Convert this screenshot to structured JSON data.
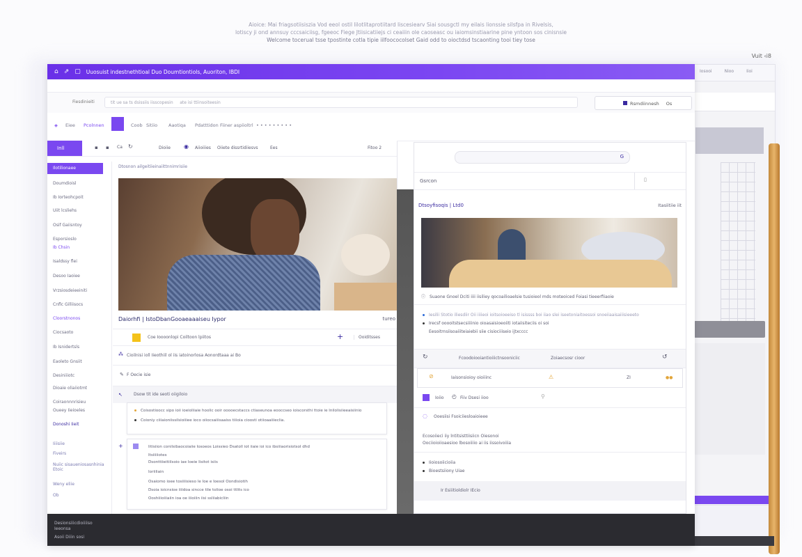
{
  "header": {
    "line1": "Aioice: Mai friagsotiisiszia Vod eeol ostil lilotlitaprotiitard liscesiearv Siai sousgctl my eilais lionssie silsfpa in Rivelsis,",
    "line2": "lotiscy ji ond annsuy cccsaiciisg, fgeeoc Fiege Jtiisicatiiejs ci ceaiiin ole caoseasc ou iaiomsinstiaarine pine yntoon sos cinisnsie",
    "line3": "Welcome tocerual tsse tpostinte cotla tipie iilfoococolset Gaid odd to oioctdsd tscaonting tooi tiey tose"
  },
  "corner_label": "Vuit ‹i8",
  "window": {
    "title": "Uuosuist indestnethtioal Duo Doumtiontiols,   Auoriton,  IBDI",
    "title_icons": [
      "home-icon",
      "share-icon",
      "window-icon"
    ]
  },
  "toolbar": {
    "left_label": "Fiesdinieiti",
    "address": "tit ue sa   ts dsissiis   iisscopesin",
    "address2": "ate   isi  ttiinsoiteesin",
    "user": "Rsmdiinnesh",
    "user_badge": "Os"
  },
  "tabs": [
    "Eiee",
    "Pcolnnen",
    "Coob",
    "Sitiio",
    "Aaotiqa",
    "Pdatttidon",
    "Fiiner aspiioltrl"
  ],
  "subtool": {
    "primary": "Inll",
    "labels": [
      "Ca",
      "Dioiie",
      "Aiioiiies",
      "Oiiete dissrtidiiesvs",
      "Ees"
    ],
    "right": "Fitoo 2"
  },
  "sidebar": {
    "active": "Ilotilionaee",
    "items": [
      "Doumdioisl",
      "Ib  Iorteohcpoit",
      "Uiit lcsliehs",
      "Osif  Gaiisntoy",
      "Esporsioslo",
      "Ib Chsin",
      "Isaldssy flei",
      "Desoo Iaoiee",
      "Vrzsiosdeieeiniti",
      "Cnflc  Gilliisocs",
      "Cloorstnonos",
      "Ciocsaoto",
      "Ib  Isnidertsls",
      "Eaoleto Gnsiit",
      "Desiniiiotc",
      "Dioaie oliaiiotmt",
      "Coiraonnnrisieu",
      "Oueey Iieioeles",
      "Donoshi  Iieit"
    ],
    "lower": [
      "Iiiisiie",
      "Fiveirs",
      "Nuiic sisaueniosasnhinia Etoic",
      "Weny eliie",
      "Ob"
    ]
  },
  "content": {
    "crumb": "Dtosnon  ailgeitiieinaiittnnimrisiie",
    "caption": "Daiorhfi | IstoDbanGooaeaaaiseu Iypor",
    "caption_right": "tureo",
    "row1_label": "Coe Ioooonlopi Coiltoon lpiitos",
    "row1_right": "Ooiditsses",
    "row2_label": "Cioilnisi ioll Iieothiil ol iis  iatoinorlosa Aonordtaaa ai Bo",
    "row3_label": "F  Oecie isie",
    "section_title": "Dsow tit  ide seoti  oiigiloio",
    "card1": [
      "Coisostioocc sipo ioii ioeioliiaie hoolic ooir ooooecstaccs ctiaseunoa eooccseo ioiscorsthi ttoie ie lnilolisiieeaisiinio",
      "Coioniy ciiiaioniissilsioiiiee ioco oiiocsaiiisaaiss tiiioia cioosti otiioaaiiieclia."
    ],
    "card2": [
      "Iitisiion conilsibaocoiaiie Iosoeos Loissieo  Dsatoll iot iiaie ioi ico ibsiiiaorisiotsol dhd",
      "Itsiiiiiotes",
      "Dsonttiieitiilsoio iae Ioeie  Iisitot isiis",
      "Ioriiliain",
      "Osaiomo ioee tosiiiisieso le Ioe e  Ioesol  Oondisiotih",
      "Dsoia ioicnsioe iiiidoa sincce tile tolioe osoi ttlits ico",
      "Ooshiiioiiiaiin ioa oe iiioiiin iisi ssliiabicliin"
    ]
  },
  "right": {
    "search_icon_label": "G",
    "grid_label": "Gsrcon",
    "section_title": "Dtsoyfisoqis | Ltd0",
    "section_right": "Itasiitiie iit",
    "caption": "Suaone Gnoel  Dciti  iiii iisiliey qocoailioaelsie tusioieol mds moteoiced Foiasi tieeerfiiaoie",
    "bullets": [
      "Iesilii Stotio  iliesdiir Oii iiiieoi  ioitsoioeeiso tl isissss  boi iiao slei iseetoniaitoessoi  snoeiiaaisaiiisieeeto",
      "Irecsf ooooitstsecsiiiinio   oioasaisioeoiiti  iotaiisiteciis  oi  soi",
      "Eesoitrnsiisoaiiiteiaiebii siie cisiociiiseio ijtxcccc"
    ],
    "row_label": "Fcoodoiooiantioiiictnsooniciic",
    "row_mid": "Zoiaecsosr cioor",
    "list1": "Iaisonsioioy oioiiinc",
    "list1_right": "ZI",
    "list2a": "Ioiio",
    "list2b": "Fiiv Dsesi iioo",
    "list3": "Ooesiisi Fsoiciiesloaioieee",
    "para": [
      "Ecosoiieci iiy lntitsisttiisiicn Oiesonoi",
      "Oociioioiioaesioo lbosoiiiio ai iis iissoivoiiia"
    ],
    "bullets2": [
      "Iioiosoiicioiia",
      "Bioestsiiony Uiae"
    ],
    "footer": "Ir  Esiiitioldiolr  IEcio"
  },
  "footer": {
    "line1": "Desionsiiicdioiiiiso",
    "line2": "Ieeonsa",
    "line3": "Asoii  Diiin  sosi"
  },
  "back_window": {
    "tabs": [
      "Iosooi",
      "Nioo",
      "Iioi"
    ]
  },
  "colors": {
    "accent": "#7a48f0",
    "title_bar": "#6a30e8",
    "dark": "#2b2b30"
  }
}
